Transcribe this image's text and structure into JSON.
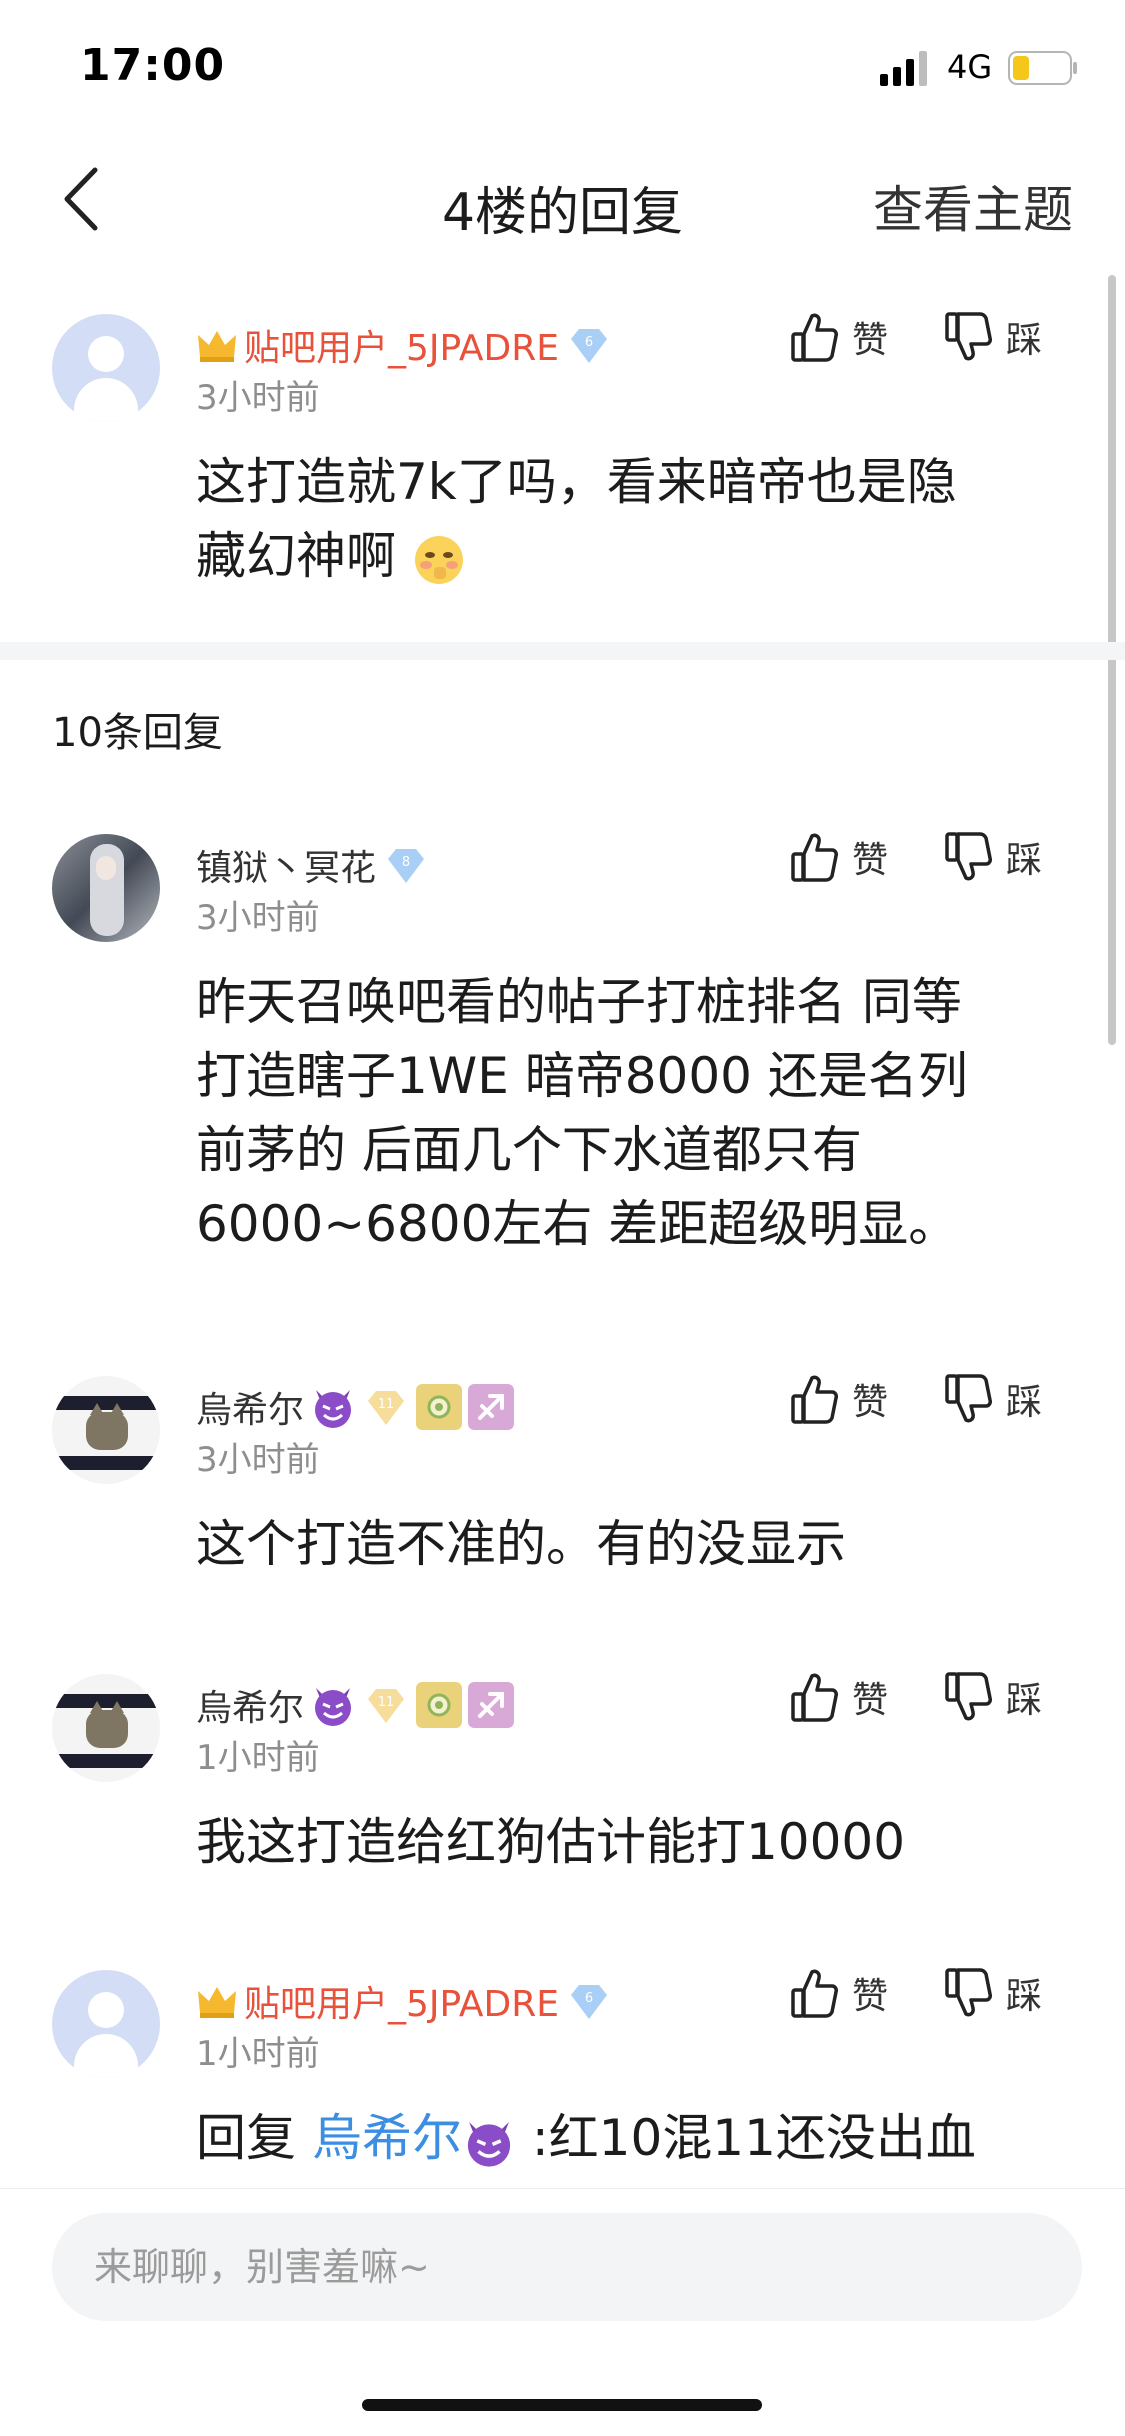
{
  "status_bar": {
    "time": "17:00",
    "network": "4G"
  },
  "header": {
    "title": "4楼的回复",
    "view_topic_label": "查看主题"
  },
  "actions": {
    "like_label": "赞",
    "dislike_label": "踩"
  },
  "main_post": {
    "username": "贴吧用户_5JPADRE",
    "level": "6",
    "time": "3小时前",
    "content_line1": "这打造就7k了吗，看来暗帝也是隐",
    "content_line2": "藏幻神啊"
  },
  "reply_count_label": "10条回复",
  "replies": [
    {
      "username": "镇狱丶冥花",
      "level": "8",
      "time": "3小时前",
      "lines": [
        "昨天召唤吧看的帖子打桩排名 同等",
        "打造瞎子1WE 暗帝8000 还是名列",
        "前茅的 后面几个下水道都只有",
        "6000~6800左右 差距超级明显。"
      ]
    },
    {
      "username": "烏希尔",
      "level": "11",
      "time": "3小时前",
      "lines": [
        "这个打造不准的。有的没显示"
      ]
    },
    {
      "username": "烏希尔",
      "level": "11",
      "time": "1小时前",
      "lines": [
        "我这打造给红狗估计能打10000"
      ]
    },
    {
      "username": "贴吧用户_5JPADRE",
      "level": "6",
      "time": "1小时前",
      "reply_prefix": "回复",
      "mention": "烏希尔",
      "reply_rest": ":红10混11还没出血"
    }
  ],
  "input": {
    "placeholder": "来聊聊，别害羞嘛~"
  },
  "colors": {
    "accent_blue": "#3b8ee2",
    "username_red": "#e8513a",
    "badge_blue": "#9cc7f5",
    "badge_gold": "#f5dc9a"
  }
}
